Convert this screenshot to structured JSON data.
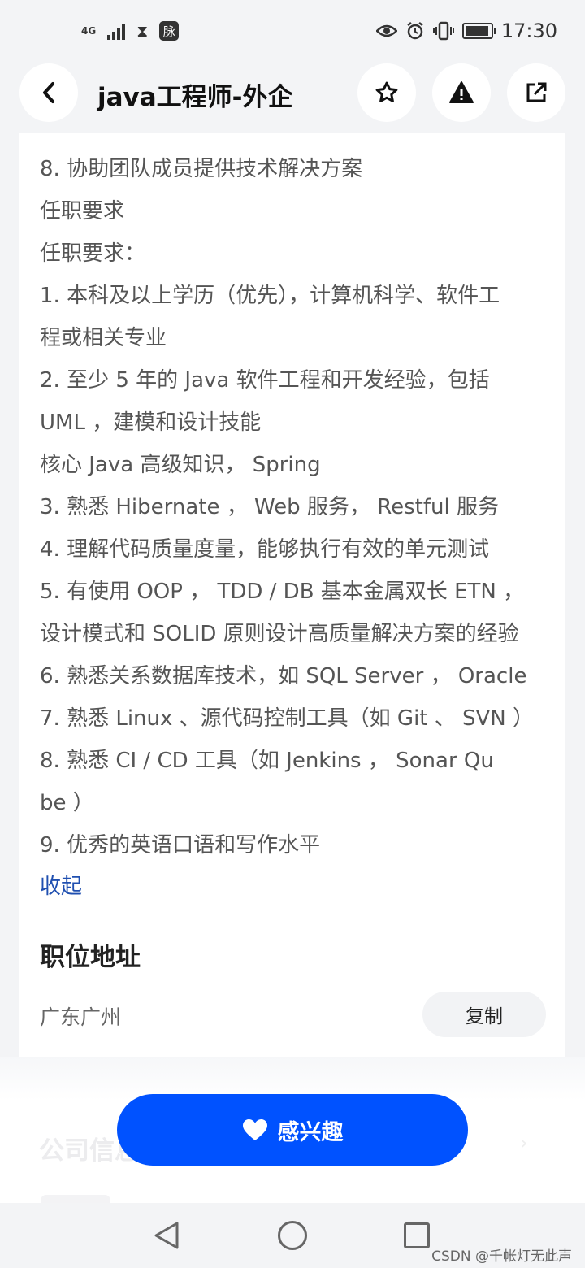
{
  "status_bar": {
    "network": "4G",
    "badge": "脉",
    "time": "17:30"
  },
  "header": {
    "title": "java工程师-外企"
  },
  "job_description": {
    "lines": [
      "8. 协助团队成员提供技术解决方案",
      "任职要求",
      "任职要求：",
      "1. 本科及以上学历（优先），计算机科学、软件工",
      "程或相关专业",
      "2. 至少 5 年的 Java 软件工程和开发经验，包括",
      "UML ，建模和设计技能",
      "核心 Java 高级知识， Spring",
      "3. 熟悉 Hibernate ， Web 服务， Restful 服务",
      "4. 理解代码质量度量，能够执行有效的单元测试",
      "5. 有使用 OOP ， TDD / DB 基本金属双长 ETN ，",
      "设计模式和 SOLID 原则设计高质量解决方案的经验",
      "6. 熟悉关系数据库技术，如 SQL Server ， Oracle",
      "7. 熟悉 Linux 、源代码控制工具（如 Git 、 SVN ）",
      "8. 熟悉 CI / CD 工具（如 Jenkins ， Sonar Qu",
      "be ）",
      "9. 优秀的英语口语和写作水平"
    ],
    "collapse_label": "收起"
  },
  "location": {
    "section_title": "职位地址",
    "address": "广东广州",
    "copy_label": "复制"
  },
  "faded": {
    "next_section_title": "公司信息"
  },
  "cta": {
    "label": "感兴趣"
  },
  "watermark": "CSDN @千帐灯无此声",
  "colors": {
    "accent": "#0052ff",
    "link": "#1f4fb0",
    "background": "#f3f4f6"
  }
}
